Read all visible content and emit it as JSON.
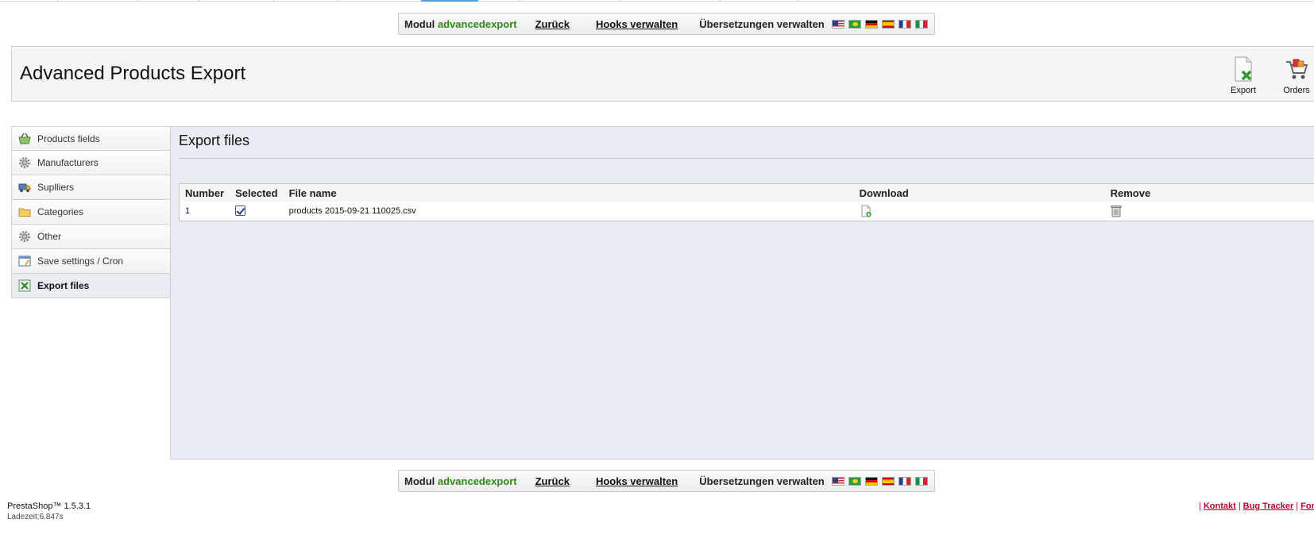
{
  "toolbar": {
    "module_prefix": "Modul",
    "module_name": "advancedexport",
    "back_label": "Zurück",
    "hooks_label": "Hooks verwalten",
    "translations_label": "Übersetzungen verwalten",
    "flags": [
      "gb-flag-icon",
      "br-flag-icon",
      "de-flag-icon",
      "es-flag-icon",
      "fr-flag-icon",
      "it-flag-icon"
    ]
  },
  "header": {
    "title": "Advanced Products Export",
    "tools": [
      {
        "label": "Export",
        "icon": "export-file-icon"
      },
      {
        "label": "Orders",
        "icon": "orders-cart-icon"
      }
    ]
  },
  "sidebar": {
    "items": [
      {
        "label": "Products fields",
        "icon": "basket-icon"
      },
      {
        "label": "Manufacturers",
        "icon": "gear-icon"
      },
      {
        "label": "Suplliers",
        "icon": "truck-icon"
      },
      {
        "label": "Categories",
        "icon": "folder-icon"
      },
      {
        "label": "Other",
        "icon": "gear-icon"
      },
      {
        "label": "Save settings / Cron",
        "icon": "settings-window-icon"
      },
      {
        "label": "Export files",
        "icon": "excel-file-icon",
        "active": true
      }
    ]
  },
  "main": {
    "title": "Export files",
    "table": {
      "headers": [
        "Number",
        "Selected",
        "File name",
        "Download",
        "Remove"
      ],
      "rows": [
        {
          "number": "1",
          "selected": true,
          "file_name": "products 2015-09-21 110025.csv",
          "download_icon": "download-file-icon",
          "remove_icon": "trash-icon"
        }
      ]
    }
  },
  "footer": {
    "version": "PrestaShop™ 1.5.3.1",
    "load_time": "Ladezeit:6.847s",
    "links": [
      "Kontakt",
      "Bug Tracker",
      "Forum"
    ]
  },
  "colors": {
    "module_name": "#2e8a17",
    "content_bg": "#e9edf3",
    "footer_link": "#c0002e"
  }
}
